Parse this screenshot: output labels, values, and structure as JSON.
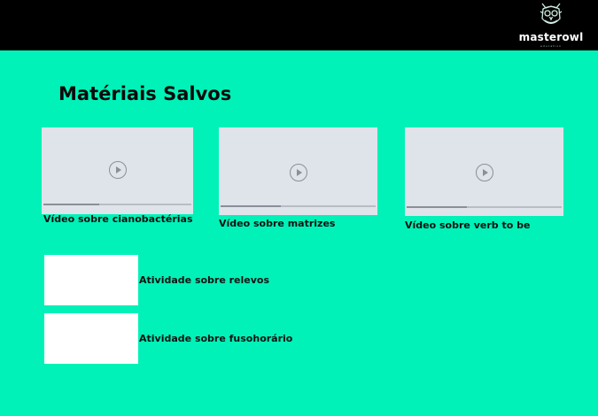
{
  "brand": {
    "name": "masterowl",
    "tagline": "education"
  },
  "page": {
    "title": "Matériais Salvos"
  },
  "videos": [
    {
      "label": "Vídeo sobre cianobactérias",
      "icon": "play-icon",
      "progress": 0.38
    },
    {
      "label": "Vídeo sobre matrizes",
      "icon": "play-icon",
      "progress": 0.39
    },
    {
      "label": "Vídeo sobre verb to be",
      "icon": "play-icon",
      "progress": 0.39
    }
  ],
  "activities": [
    {
      "label": "Atividade sobre relevos"
    },
    {
      "label": "Atividade sobre fusohorário"
    }
  ],
  "colors": {
    "background": "#00f2b8",
    "header": "#000000",
    "thumbnail": "#dfe3ea"
  }
}
